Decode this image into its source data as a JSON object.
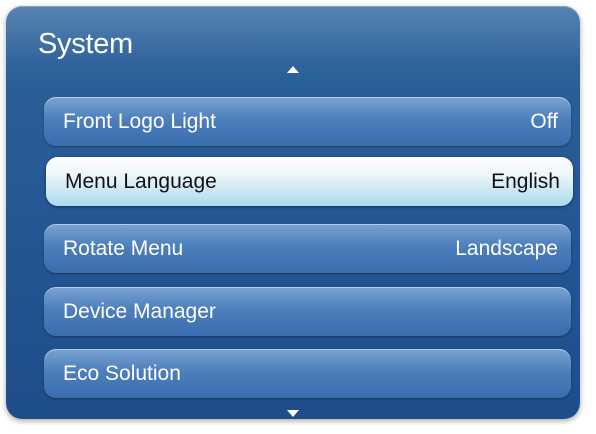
{
  "menu": {
    "title": "System",
    "items": [
      {
        "label": "Front Logo Light",
        "value": "Off",
        "selected": false
      },
      {
        "label": "Menu Language",
        "value": "English",
        "selected": true
      },
      {
        "label": "Rotate Menu",
        "value": "Landscape",
        "selected": false
      },
      {
        "label": "Device Manager",
        "value": "",
        "selected": false
      },
      {
        "label": "Eco Solution",
        "value": "",
        "selected": false
      }
    ]
  },
  "icons": {
    "scroll_up": "triangle-up-icon",
    "scroll_down": "triangle-down-icon"
  },
  "colors": {
    "panel": "#245694",
    "item": "#4d7fbc",
    "selected_item": "#c7e6f3"
  }
}
